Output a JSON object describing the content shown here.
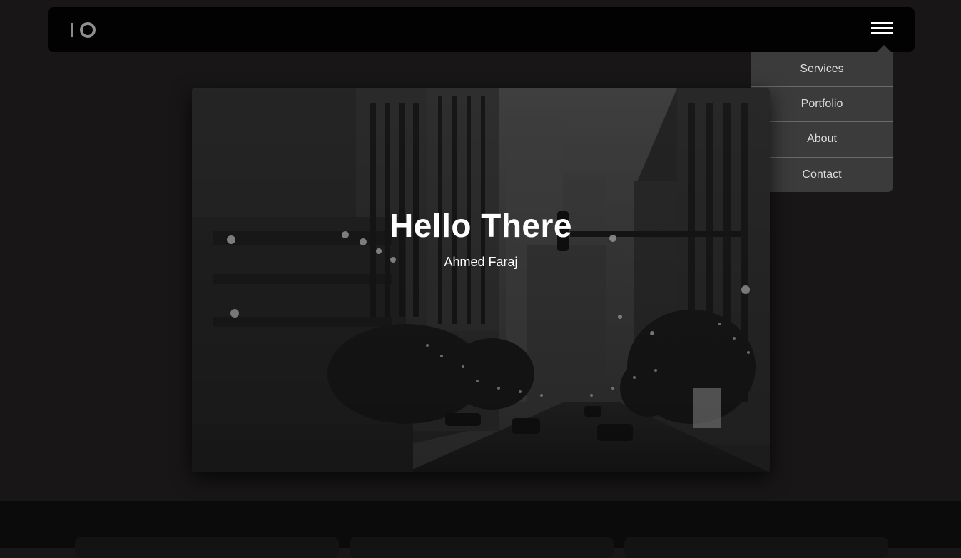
{
  "header": {
    "logo_icon": "io-logo-icon",
    "menu_icon": "hamburger-menu-icon"
  },
  "menu": {
    "items": [
      {
        "label": "Services"
      },
      {
        "label": "Portfolio"
      },
      {
        "label": "About"
      },
      {
        "label": "Contact"
      }
    ]
  },
  "hero": {
    "title": "Hello There",
    "subtitle": "Ahmed Faraj"
  },
  "colors": {
    "page_background": "#181617",
    "navbar": "#020202",
    "dropdown": "#3b3b3b",
    "text": "#ffffff"
  }
}
